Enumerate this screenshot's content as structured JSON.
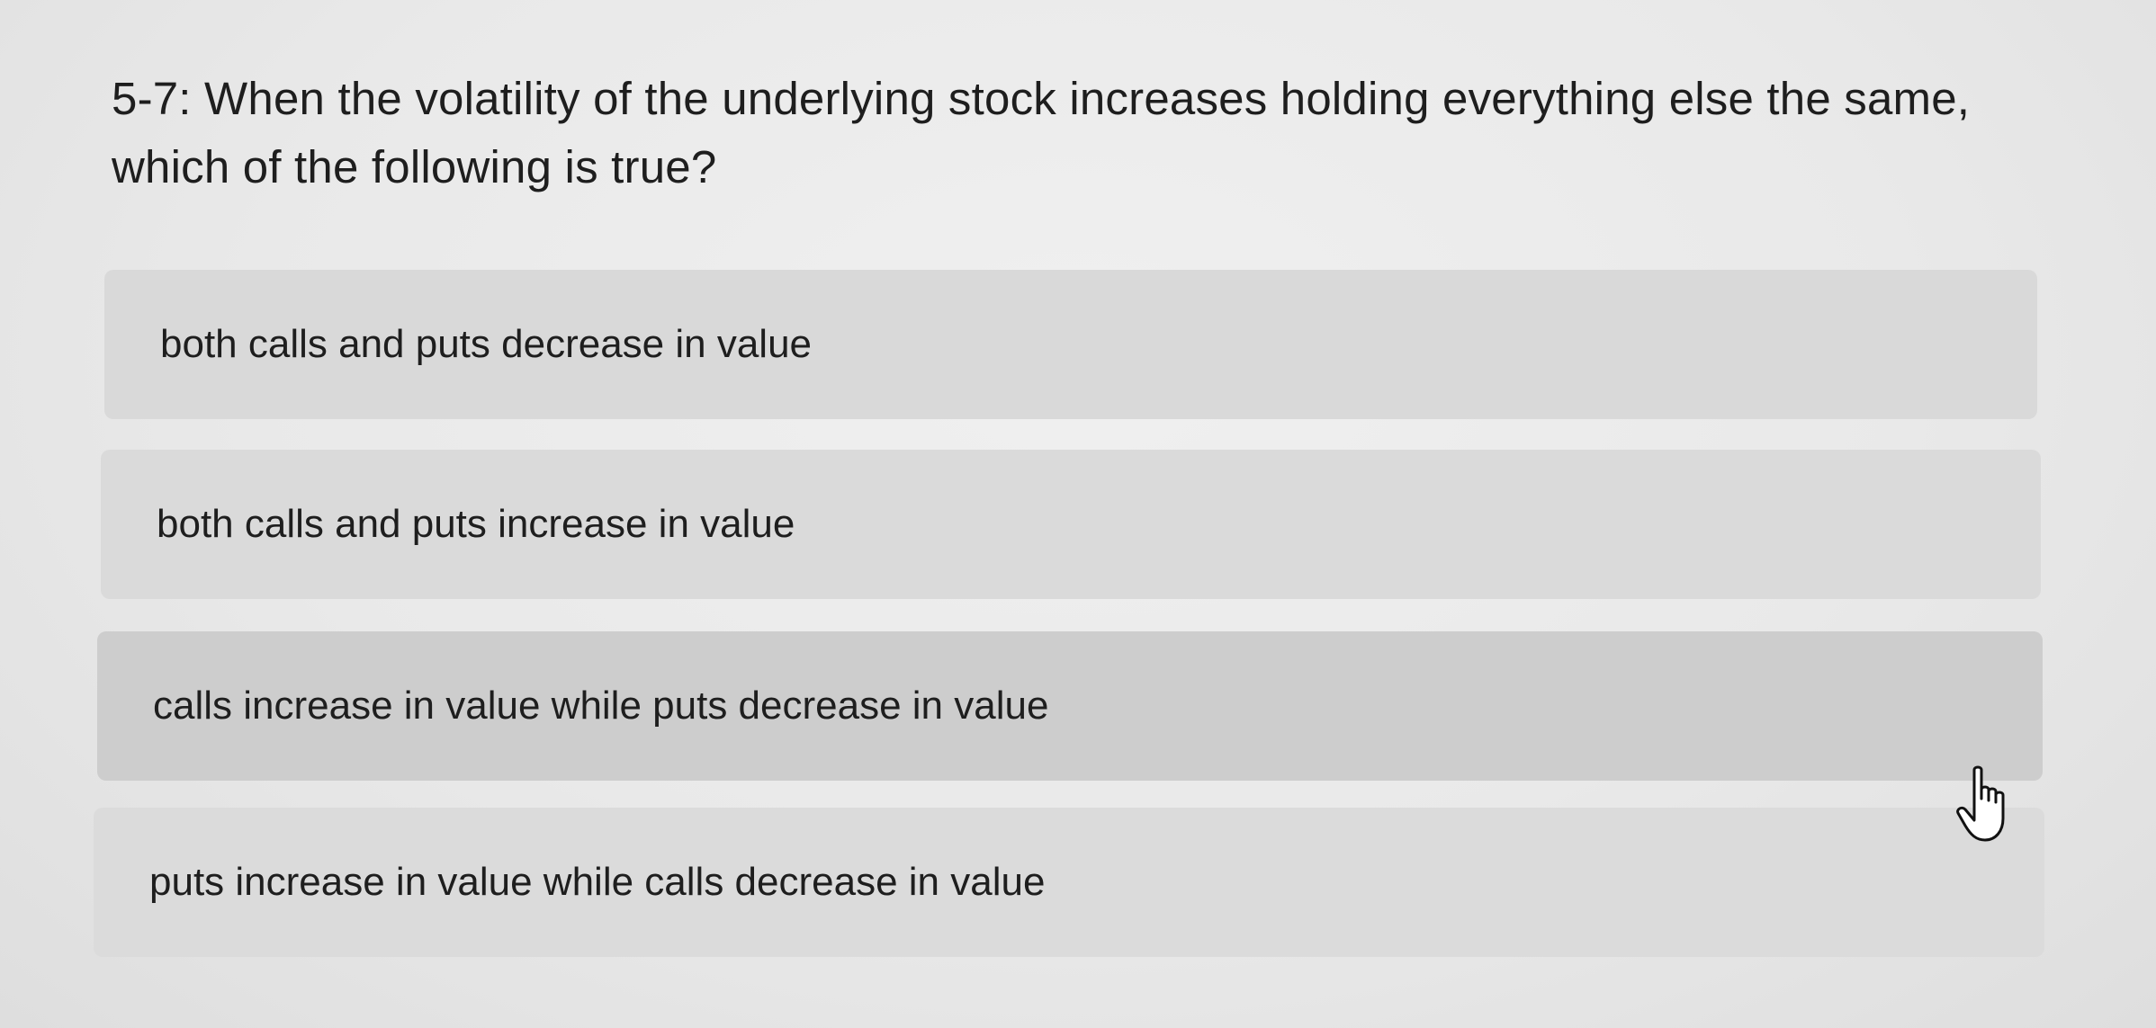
{
  "question": {
    "text": "5-7: When the volatility of the underlying stock increases holding everything else the same, which of the following is true?"
  },
  "options": [
    {
      "label": "both calls and puts decrease in value"
    },
    {
      "label": "both calls and puts increase in value"
    },
    {
      "label": "calls increase in value while puts decrease in value"
    },
    {
      "label": "puts increase in value while calls decrease in value"
    }
  ],
  "cursor": {
    "icon": "hand-pointer-icon"
  },
  "colors": {
    "background": "#e9e9e9",
    "option_background": "#dadada",
    "option_hover_background": "#cdcdcd",
    "text": "#1e1e1e"
  }
}
